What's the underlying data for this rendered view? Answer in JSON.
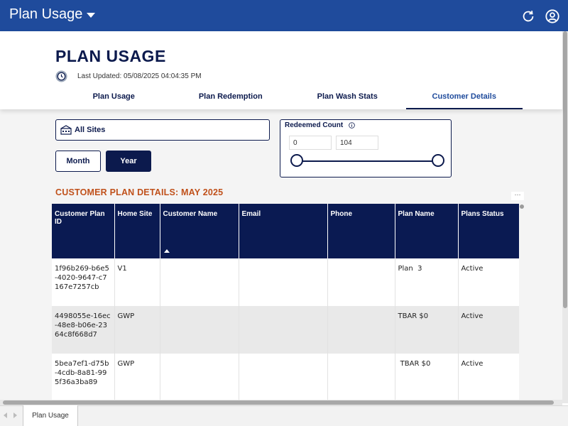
{
  "app": {
    "title": "Plan Usage"
  },
  "header": {
    "page_title": "PLAN USAGE",
    "last_updated": "Last Updated: 05/08/2025 04:04:35 PM"
  },
  "tabs": [
    {
      "label": "Plan Usage",
      "active": false
    },
    {
      "label": "Plan Redemption",
      "active": false
    },
    {
      "label": "Plan Wash Stats",
      "active": false
    },
    {
      "label": "Customer Details",
      "active": true
    }
  ],
  "filters": {
    "site": "All Sites",
    "period_buttons": [
      {
        "label": "Month",
        "selected": false
      },
      {
        "label": "Year",
        "selected": true
      }
    ],
    "redeemed_count": {
      "label": "Redeemed Count",
      "min": "0",
      "max": "104"
    }
  },
  "section_title": "CUSTOMER PLAN DETAILS: MAY 2025",
  "table": {
    "columns": [
      "Customer Plan ID",
      "Home Site",
      "Customer Name",
      "Email",
      "Phone",
      "Plan Name",
      "Plans Status"
    ],
    "sorted_column": "Customer Name",
    "rows": [
      [
        "1f96b269-b6e5-4020-9647-c7167e7257cb",
        "V1",
        "",
        "",
        "",
        "Plan  3",
        "Active"
      ],
      [
        "4498055e-16ec-48e8-b06e-2364c8f668d7",
        "GWP",
        "",
        "",
        "",
        "TBAR $0",
        "Active"
      ],
      [
        "5bea7ef1-d75b-4cdb-8a81-995f36a3ba89",
        "GWP",
        "",
        "",
        "",
        " TBAR $0",
        "Active"
      ]
    ]
  },
  "bottom": {
    "sheet_tab": "Plan Usage"
  },
  "colors": {
    "topbar": "#1f4b9c",
    "navy": "#0c1a4d",
    "table_header": "#0a1a52",
    "accent_orange": "#c0511b"
  },
  "icons": {
    "refresh": "refresh-icon",
    "account": "account-circle-icon",
    "clock": "clock-icon",
    "site": "building-icon",
    "info": "info-icon"
  }
}
